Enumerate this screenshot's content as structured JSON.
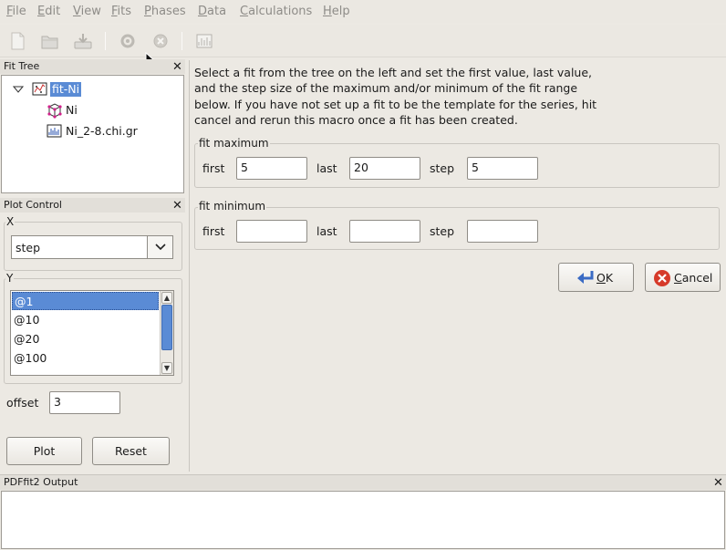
{
  "menubar": {
    "items": [
      {
        "label": "File",
        "mnemonic": "F",
        "rest": "ile"
      },
      {
        "label": "Edit",
        "mnemonic": "E",
        "rest": "dit"
      },
      {
        "label": "View",
        "mnemonic": "V",
        "rest": "iew"
      },
      {
        "label": "Fits",
        "mnemonic": "F",
        "rest": "its"
      },
      {
        "label": "Phases",
        "mnemonic": "P",
        "rest": "hases"
      },
      {
        "label": "Data",
        "mnemonic": "D",
        "rest": "ata"
      },
      {
        "label": "Calculations",
        "mnemonic": "C",
        "rest": "alculations"
      },
      {
        "label": "Help",
        "mnemonic": "H",
        "rest": "elp"
      }
    ]
  },
  "fit_tree": {
    "title": "Fit Tree",
    "items": [
      {
        "label": "fit-Ni",
        "kind": "fit",
        "selected": true
      },
      {
        "label": "Ni",
        "kind": "phase"
      },
      {
        "label": "Ni_2-8.chi.gr",
        "kind": "data"
      }
    ]
  },
  "plot_control": {
    "title": "Plot Control",
    "x_group": "X",
    "x_value": "step",
    "y_group": "Y",
    "y_items": [
      "@1",
      "@10",
      "@20",
      "@100"
    ],
    "offset_label": "offset",
    "offset_value": "3",
    "plot_label": "Plot",
    "reset_label": "Reset"
  },
  "macro": {
    "instructions": [
      "Select a fit from the tree on the left and set the first value, last value,",
      "and the step size of the maximum and/or minimum of the fit range",
      "below. If you have not set up a fit to be the template for the series, hit",
      "cancel and rerun this macro once a fit has been created."
    ],
    "fit_maximum": {
      "title": "fit maximum",
      "first_label": "first",
      "first": "5",
      "last_label": "last",
      "last": "20",
      "step_label": "step",
      "step": "5"
    },
    "fit_minimum": {
      "title": "fit minimum",
      "first_label": "first",
      "first": "",
      "last_label": "last",
      "last": "",
      "step_label": "step",
      "step": ""
    },
    "ok_label": "OK",
    "ok_mnemonic": "O",
    "ok_rest": "K",
    "cancel_label": "Cancel",
    "cancel_mnemonic": "C",
    "cancel_rest": "ancel"
  },
  "output": {
    "title": "PDFfit2 Output",
    "text": ""
  },
  "colors": {
    "selection": "#5a8bd5",
    "cancel_icon": "#d63a2a",
    "background": "#ece9e3"
  }
}
